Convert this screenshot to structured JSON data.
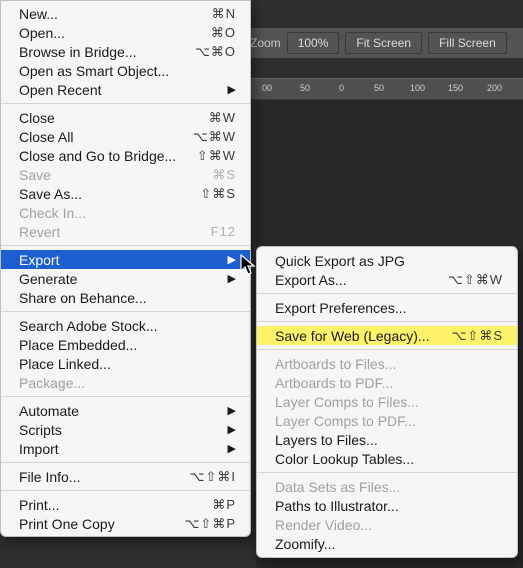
{
  "toolbar": {
    "zoom_label": "Zoom",
    "btn100": "100%",
    "btnFit": "Fit Screen",
    "btnFill": "Fill Screen"
  },
  "ruler": {
    "ticks": [
      "00",
      "50",
      "0",
      "50",
      "100",
      "150",
      "200"
    ]
  },
  "file_menu": [
    {
      "label": "New...",
      "shortcut": "⌘N"
    },
    {
      "label": "Open...",
      "shortcut": "⌘O"
    },
    {
      "label": "Browse in Bridge...",
      "shortcut": "⌥⌘O"
    },
    {
      "label": "Open as Smart Object..."
    },
    {
      "label": "Open Recent",
      "submenu": true
    },
    {
      "sep": true
    },
    {
      "label": "Close",
      "shortcut": "⌘W"
    },
    {
      "label": "Close All",
      "shortcut": "⌥⌘W"
    },
    {
      "label": "Close and Go to Bridge...",
      "shortcut": "⇧⌘W"
    },
    {
      "label": "Save",
      "shortcut": "⌘S",
      "disabled": true
    },
    {
      "label": "Save As...",
      "shortcut": "⇧⌘S"
    },
    {
      "label": "Check In...",
      "disabled": true
    },
    {
      "label": "Revert",
      "shortcut": "F12",
      "disabled": true
    },
    {
      "sep": true
    },
    {
      "label": "Export",
      "submenu": true,
      "highlight": true
    },
    {
      "label": "Generate",
      "submenu": true
    },
    {
      "label": "Share on Behance..."
    },
    {
      "sep": true
    },
    {
      "label": "Search Adobe Stock..."
    },
    {
      "label": "Place Embedded..."
    },
    {
      "label": "Place Linked..."
    },
    {
      "label": "Package...",
      "disabled": true
    },
    {
      "sep": true
    },
    {
      "label": "Automate",
      "submenu": true
    },
    {
      "label": "Scripts",
      "submenu": true
    },
    {
      "label": "Import",
      "submenu": true
    },
    {
      "sep": true
    },
    {
      "label": "File Info...",
      "shortcut": "⌥⇧⌘I"
    },
    {
      "sep": true
    },
    {
      "label": "Print...",
      "shortcut": "⌘P"
    },
    {
      "label": "Print One Copy",
      "shortcut": "⌥⇧⌘P"
    }
  ],
  "export_submenu": [
    {
      "label": "Quick Export as JPG"
    },
    {
      "label": "Export As...",
      "shortcut": "⌥⇧⌘W"
    },
    {
      "sep": true
    },
    {
      "label": "Export Preferences..."
    },
    {
      "sep": true
    },
    {
      "label": "Save for Web (Legacy)...",
      "shortcut": "⌥⇧⌘S",
      "yellow": true
    },
    {
      "sep": true
    },
    {
      "label": "Artboards to Files...",
      "disabled": true
    },
    {
      "label": "Artboards to PDF...",
      "disabled": true
    },
    {
      "label": "Layer Comps to Files...",
      "disabled": true
    },
    {
      "label": "Layer Comps to PDF...",
      "disabled": true
    },
    {
      "label": "Layers to Files..."
    },
    {
      "label": "Color Lookup Tables..."
    },
    {
      "sep": true
    },
    {
      "label": "Data Sets as Files...",
      "disabled": true
    },
    {
      "label": "Paths to Illustrator..."
    },
    {
      "label": "Render Video...",
      "disabled": true
    },
    {
      "label": "Zoomify..."
    }
  ]
}
